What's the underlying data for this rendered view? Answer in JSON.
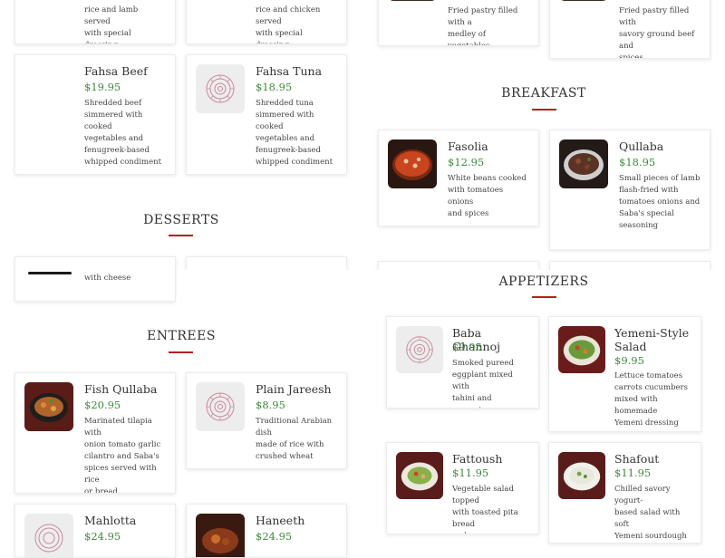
{
  "top_partial": {
    "left1_desc": "rice and lamb served\nwith special dressing",
    "left2_desc": "rice and chicken served\nwith special dressing",
    "right1_desc": "Fried pastry filled with a\nmedley of vegetables",
    "right2_desc": "Fried pastry filled with\nsavory ground beef and\nspices"
  },
  "items": {
    "fahsa_beef": {
      "name": "Fahsa Beef",
      "price": "$19.95",
      "desc": "Shredded beef\nsimmered with cooked\nvegetables and\nfenugreek-based\nwhipped condiment"
    },
    "fahsa_tuna": {
      "name": "Fahsa Tuna",
      "price": "$18.95",
      "desc": "Shredded tuna\nsimmered with cooked\nvegetables and\nfenugreek-based\nwhipped condiment"
    },
    "fasolia": {
      "name": "Fasolia",
      "price": "$12.95",
      "desc": "White beans cooked\nwith tomatoes onions\nand spices"
    },
    "qullaba": {
      "name": "Qullaba",
      "price": "$18.95",
      "desc": "Small pieces of lamb\nflash-fried with\ntomatoes onions and\nSaba's special\nseasoning"
    },
    "fish_qullaba": {
      "name": "Fish Qullaba",
      "price": "$20.95",
      "desc": "Marinated tilapia with\nonion tomato garlic\ncilantro and Saba's\nspices served with rice\nor bread"
    },
    "plain_jareesh": {
      "name": "Plain Jareesh",
      "price": "$8.95",
      "desc": "Traditional Arabian dish\nmade of rice with\ncrushed wheat"
    },
    "mahlotta": {
      "name": "Mahlotta",
      "price": "$24.95"
    },
    "haneeth": {
      "name": "Haneeth",
      "price": "$24.95"
    },
    "baba_ghannoj": {
      "name": "Baba Ghannoj",
      "price": "$9.95",
      "desc": "Smoked pureed\neggplant mixed with\ntahini and seasonings"
    },
    "yemeni_salad": {
      "name": "Yemeni-Style\nSalad",
      "price": "$9.95",
      "desc": "Lettuce tomatoes\ncarrots cucumbers\nmixed with homemade\nYemeni dressing"
    },
    "fattoush": {
      "name": "Fattoush",
      "price": "$11.95",
      "desc": "Vegetable salad topped\nwith toasted pita bread\nand sumac"
    },
    "shafout": {
      "name": "Shafout",
      "price": "$11.95",
      "desc": "Chilled savory yogurt-\nbased salad with soft\nYemeni sourdough\nbread"
    }
  },
  "sections": {
    "breakfast": "BREAKFAST",
    "desserts": "DESSERTS",
    "entrees": "ENTREES",
    "appetizers": "APPETIZERS"
  },
  "desserts_partial": {
    "item1_desc": "with cheese"
  },
  "colors": {
    "accent": "#b3201d",
    "price": "#3d8a3a",
    "logo": "#c98a9b"
  }
}
